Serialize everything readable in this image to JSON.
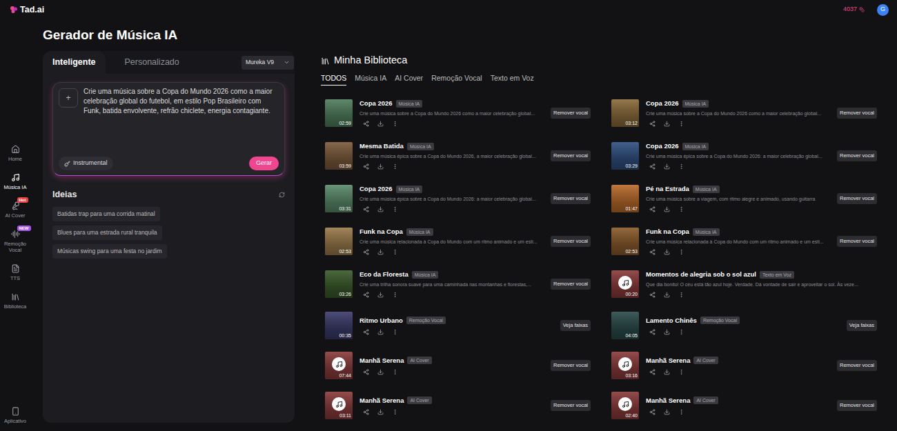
{
  "app": {
    "logo": "Tad.ai",
    "credits": "4037",
    "avatar": "G"
  },
  "sidebar": {
    "items": [
      {
        "label": "Home",
        "selected": false
      },
      {
        "label": "Música IA",
        "selected": true
      },
      {
        "label": "AI Cover",
        "selected": false,
        "badge": "Hot",
        "badge_color": "#ef4444"
      },
      {
        "label": "Remoção Vocal",
        "selected": false,
        "badge": "NEW",
        "badge_color": "#a855f7"
      },
      {
        "label": "TTS",
        "selected": false
      },
      {
        "label": "Biblioteca",
        "selected": false
      }
    ],
    "bottom": {
      "label": "Aplicativo",
      "selected": false
    }
  },
  "page_title": "Gerador de Música IA",
  "generator": {
    "tabs": [
      {
        "label": "Inteligente",
        "selected": true
      },
      {
        "label": "Personalizado",
        "selected": false
      }
    ],
    "model": "Mureka V9",
    "add_button": "+",
    "prompt": "Crie uma música sobre a Copa do Mundo 2026 como a maior celebração global do futebol, em estilo Pop Brasileiro com Funk, batida envolvente, refrão chiclete, energia contagiante.",
    "instrumental": "Instrumental",
    "generate": "Gerar",
    "ideas": {
      "title": "Ideias",
      "items": [
        "Batidas trap para uma corrida matinal",
        "Blues para uma estrada rural tranquila",
        "Músicas swing para uma festa no jardim"
      ]
    }
  },
  "library": {
    "title": "Minha Biblioteca",
    "tabs": [
      {
        "label": "TODOS",
        "selected": true
      },
      {
        "label": "Música IA",
        "selected": false
      },
      {
        "label": "AI Cover",
        "selected": false
      },
      {
        "label": "Remoção Vocal",
        "selected": false
      },
      {
        "label": "Texto em Voz",
        "selected": false
      }
    ],
    "tracks": [
      {
        "title": "Copa 2026",
        "type": "Música IA",
        "description": "Crie uma música sobre a Copa do Mundo 2026 como a maior celebração global...",
        "duration": "02:59",
        "action": "Remover vocal",
        "kind": "photo",
        "color": "#4f7d5c"
      },
      {
        "title": "Copa 2026",
        "type": "Música IA",
        "description": "Crie uma música sobre a Copa do Mundo 2026 como a maior celebração global...",
        "duration": "03:12",
        "action": "Remover vocal",
        "kind": "photo",
        "color": "#8a6a3a"
      },
      {
        "title": "Mesma Batida",
        "type": "Música IA",
        "description": "Crie uma música épica sobre a Copa do Mundo 2026, a maior celebração global...",
        "duration": "03:59",
        "action": "Remover vocal",
        "kind": "photo",
        "color": "#7a5a3a"
      },
      {
        "title": "Copa 2026",
        "type": "Música IA",
        "description": "Crie uma música épica sobre a Copa do Mundo 2026: a maior celebração global...",
        "duration": "03:29",
        "action": "Remover vocal",
        "kind": "photo",
        "color": "#2f4f80"
      },
      {
        "title": "Copa 2026",
        "type": "Música IA",
        "description": "Crie uma música épica sobre a Copa do Mundo 2026: a maior celebração global...",
        "duration": "03:31",
        "action": "Remover vocal",
        "kind": "photo",
        "color": "#5a8a6a"
      },
      {
        "title": "Pé na Estrada",
        "type": "Música IA",
        "description": "Crie uma música sobre a viagem, com ritmo alegre e animado, usando guitarra",
        "duration": "01:47",
        "action": "Remover vocal",
        "kind": "photo",
        "color": "#b86a2a"
      },
      {
        "title": "Funk na Copa",
        "type": "Música IA",
        "description": "Crie uma música relacionada à Copa do Mundo com um ritmo animado e um esti...",
        "duration": "02:53",
        "action": "Remover vocal",
        "kind": "photo",
        "color": "#9a7a4a"
      },
      {
        "title": "Funk na Copa",
        "type": "Música IA",
        "description": "Crie uma música relacionada à Copa do Mundo com um ritmo animado e um esti...",
        "duration": "02:53",
        "action": "Remover vocal",
        "kind": "photo",
        "color": "#8a5a2a"
      },
      {
        "title": "Eco da Floresta",
        "type": "Música IA",
        "description": "Crie uma trilha sonora suave para uma caminhada nas montanhas e florestas,...",
        "duration": "03:26",
        "action": "Remover vocal",
        "kind": "photo",
        "color": "#3a5a2a"
      },
      {
        "title": "Momentos de alegria sob o sol azul",
        "type": "Texto em Voz",
        "description": "Que dia bonito! O céu está tão azul hoje. Verdade. Dá vontade de sair e aproveitar o sol. Às veze...",
        "duration": "00:20",
        "kind": "note",
        "color": "#8a3a3a"
      },
      {
        "title": "Ritmo Urbano",
        "type": "Remoção Vocal",
        "duration": "00:35",
        "action": "Veja faixas",
        "kind": "photo",
        "color": "#3a3a6a"
      },
      {
        "title": "Lamento Chinês",
        "type": "Remoção Vocal",
        "duration": "04:05",
        "action": "Veja faixas",
        "kind": "photo",
        "color": "#2a4a4a"
      },
      {
        "title": "Manhã Serena",
        "type": "AI Cover",
        "duration": "07:44",
        "action": "Remover vocal",
        "kind": "note",
        "color": "#8a3a3a"
      },
      {
        "title": "Manhã Serena",
        "type": "AI Cover",
        "duration": "03:16",
        "action": "Remover vocal",
        "kind": "note",
        "color": "#8a3a3a"
      },
      {
        "title": "Manhã Serena",
        "type": "AI Cover",
        "duration": "03:11",
        "action": "Remover vocal",
        "kind": "note",
        "color": "#8a3a3a"
      },
      {
        "title": "Manhã Serena",
        "type": "AI Cover",
        "duration": "02:40",
        "action": "Remover vocal",
        "kind": "note",
        "color": "#8a3a3a"
      }
    ]
  }
}
